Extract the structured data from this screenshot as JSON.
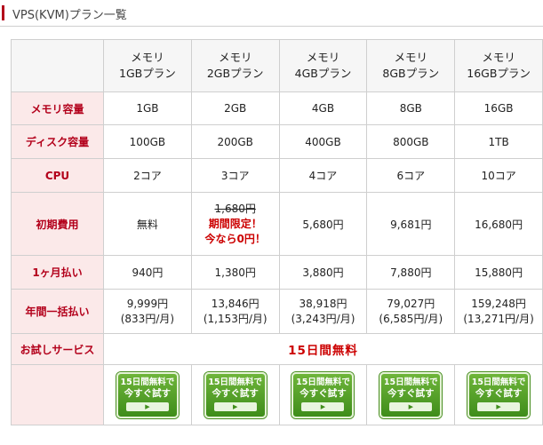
{
  "section": {
    "title": "VPS(KVM)プラン一覧"
  },
  "plans": [
    {
      "name_line1": "メモリ",
      "name_line2": "1GBプラン",
      "memory": "1GB",
      "disk": "100GB",
      "cpu": "2コア",
      "initial_fee": "無料",
      "monthly": "940円",
      "yearly": "9,999円",
      "yearly_per_month": "(833円/月)"
    },
    {
      "name_line1": "メモリ",
      "name_line2": "2GBプラン",
      "memory": "2GB",
      "disk": "200GB",
      "cpu": "3コア",
      "initial_fee_original": "1,680円",
      "initial_fee_promo_1": "期間限定！",
      "initial_fee_promo_2": "今なら0円！",
      "monthly": "1,380円",
      "yearly": "13,846円",
      "yearly_per_month": "(1,153円/月)"
    },
    {
      "name_line1": "メモリ",
      "name_line2": "4GBプラン",
      "memory": "4GB",
      "disk": "400GB",
      "cpu": "4コア",
      "initial_fee": "5,680円",
      "monthly": "3,880円",
      "yearly": "38,918円",
      "yearly_per_month": "(3,243円/月)"
    },
    {
      "name_line1": "メモリ",
      "name_line2": "8GBプラン",
      "memory": "8GB",
      "disk": "800GB",
      "cpu": "6コア",
      "initial_fee": "9,681円",
      "monthly": "7,880円",
      "yearly": "79,027円",
      "yearly_per_month": "(6,585円/月)"
    },
    {
      "name_line1": "メモリ",
      "name_line2": "16GBプラン",
      "memory": "16GB",
      "disk": "1TB",
      "cpu": "10コア",
      "initial_fee": "16,680円",
      "monthly": "15,880円",
      "yearly": "159,248円",
      "yearly_per_month": "(13,271円/月)"
    }
  ],
  "labels": {
    "memory": "メモリ容量",
    "disk": "ディスク容量",
    "cpu": "CPU",
    "initial_fee": "初期費用",
    "monthly": "1ヶ月払い",
    "yearly": "年間一括払い",
    "trial": "お試しサービス"
  },
  "trial": {
    "value": "15日間無料",
    "button_line1": "15日間無料で",
    "button_line2": "今すぐ試す",
    "button_arrow": "▶"
  },
  "colors": {
    "accent": "#b3001b",
    "label_bg": "#fbe9e9",
    "promo": "#cc0000",
    "button_green": "#4a9a22"
  }
}
